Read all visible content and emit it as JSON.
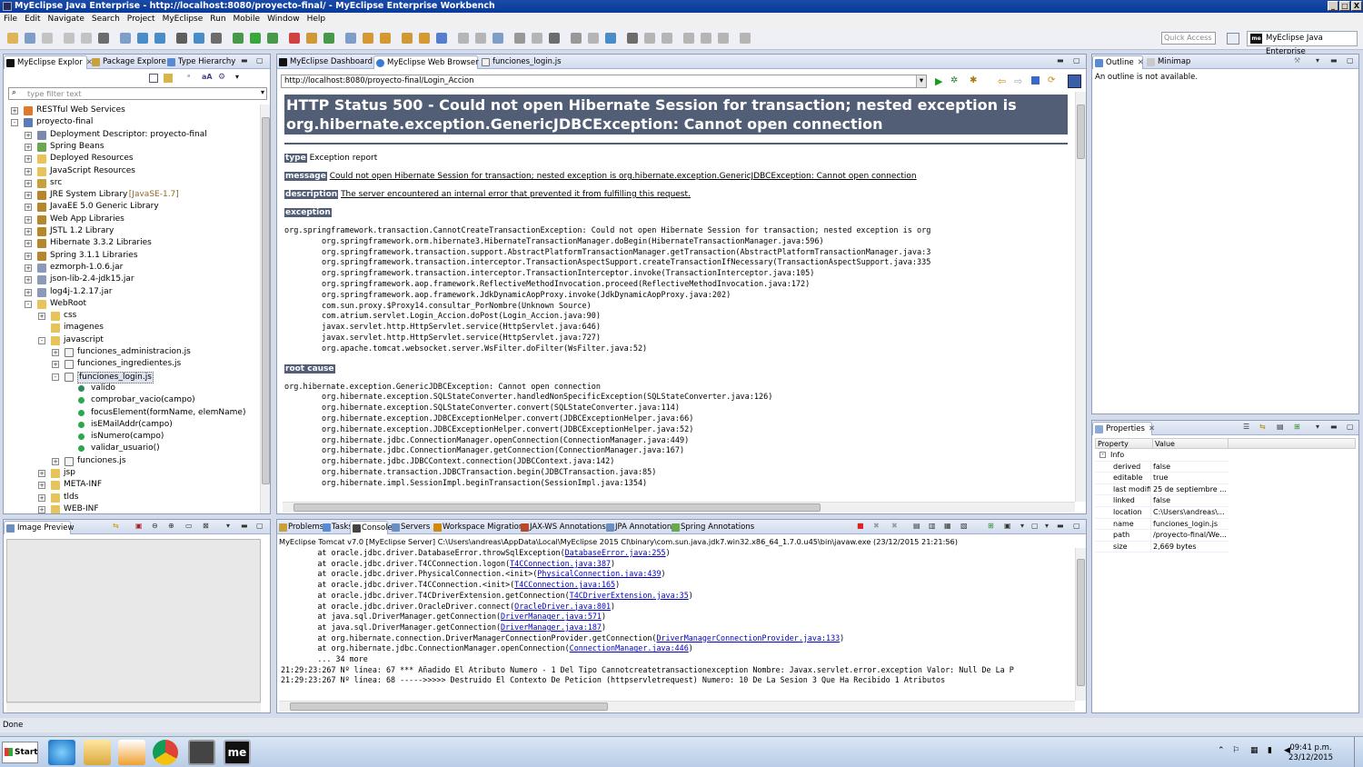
{
  "window": {
    "title": "MyEclipse Java Enterprise - http://localhost:8080/proyecto-final/ - MyEclipse Enterprise Workbench",
    "controls": [
      "_",
      "□",
      "X"
    ]
  },
  "menu": [
    "File",
    "Edit",
    "Navigate",
    "Search",
    "Project",
    "MyEclipse",
    "Run",
    "Mobile",
    "Window",
    "Help"
  ],
  "toolbar": {
    "quick_access_placeholder": "Quick Access",
    "perspective_label": "MyEclipse Java Enterprise",
    "perspective_badge": "me"
  },
  "left_panel": {
    "tabs": [
      "MyEclipse Explor",
      "Package Explore",
      "Type Hierarchy"
    ],
    "filter_placeholder": "type filter text",
    "tree": [
      {
        "label": "RESTful Web Services",
        "depth": 0,
        "expander": "+",
        "icon": "rest-icon"
      },
      {
        "label": "proyecto-final",
        "depth": 0,
        "expander": "-",
        "icon": "project-icon"
      },
      {
        "label": "Deployment Descriptor: proyecto-final",
        "depth": 1,
        "expander": "+",
        "icon": "descriptor-icon"
      },
      {
        "label": "Spring Beans",
        "depth": 1,
        "expander": "+",
        "icon": "spring-icon"
      },
      {
        "label": "Deployed Resources",
        "depth": 1,
        "expander": "+",
        "icon": "folder-icon"
      },
      {
        "label": "JavaScript Resources",
        "depth": 1,
        "expander": "+",
        "icon": "folder-icon"
      },
      {
        "label": "src",
        "depth": 1,
        "expander": "+",
        "icon": "package-folder-icon"
      },
      {
        "label": "JRE System Library",
        "suffix": "[JavaSE-1.7]",
        "depth": 1,
        "expander": "+",
        "icon": "library-icon"
      },
      {
        "label": "JavaEE 5.0 Generic Library",
        "depth": 1,
        "expander": "+",
        "icon": "library-icon"
      },
      {
        "label": "Web App Libraries",
        "depth": 1,
        "expander": "+",
        "icon": "library-icon"
      },
      {
        "label": "JSTL 1.2 Library",
        "depth": 1,
        "expander": "+",
        "icon": "library-icon"
      },
      {
        "label": "Hibernate 3.3.2 Libraries",
        "depth": 1,
        "expander": "+",
        "icon": "library-icon"
      },
      {
        "label": "Spring 3.1.1 Libraries",
        "depth": 1,
        "expander": "+",
        "icon": "library-icon"
      },
      {
        "label": "ezmorph-1.0.6.jar",
        "depth": 1,
        "expander": "+",
        "icon": "jar-icon"
      },
      {
        "label": "json-lib-2.4-jdk15.jar",
        "depth": 1,
        "expander": "+",
        "icon": "jar-icon"
      },
      {
        "label": "log4j-1.2.17.jar",
        "depth": 1,
        "expander": "+",
        "icon": "jar-icon"
      },
      {
        "label": "WebRoot",
        "depth": 1,
        "expander": "-",
        "icon": "folder-icon"
      },
      {
        "label": "css",
        "depth": 2,
        "expander": "+",
        "icon": "folder-icon"
      },
      {
        "label": "imagenes",
        "depth": 2,
        "expander": "",
        "icon": "folder-icon"
      },
      {
        "label": "javascript",
        "depth": 2,
        "expander": "-",
        "icon": "folder-icon"
      },
      {
        "label": "funciones_administracion.js",
        "depth": 3,
        "expander": "+",
        "icon": "js-file-icon"
      },
      {
        "label": "funciones_ingredientes.js",
        "depth": 3,
        "expander": "+",
        "icon": "js-file-icon"
      },
      {
        "label": "funciones_login.js",
        "depth": 3,
        "expander": "-",
        "icon": "js-file-icon",
        "selected": true
      },
      {
        "label": "valido",
        "depth": 4,
        "expander": "",
        "icon": "field-icon"
      },
      {
        "label": "comprobar_vacio(campo)",
        "depth": 4,
        "expander": "",
        "icon": "function-icon"
      },
      {
        "label": "focusElement(formName, elemName)",
        "depth": 4,
        "expander": "",
        "icon": "function-icon"
      },
      {
        "label": "isEMailAddr(campo)",
        "depth": 4,
        "expander": "",
        "icon": "function-icon"
      },
      {
        "label": "isNumero(campo)",
        "depth": 4,
        "expander": "",
        "icon": "function-icon"
      },
      {
        "label": "validar_usuario()",
        "depth": 4,
        "expander": "",
        "icon": "function-icon"
      },
      {
        "label": "funciones.js",
        "depth": 3,
        "expander": "+",
        "icon": "js-file-icon"
      },
      {
        "label": "jsp",
        "depth": 2,
        "expander": "+",
        "icon": "folder-icon"
      },
      {
        "label": "META-INF",
        "depth": 2,
        "expander": "+",
        "icon": "folder-icon"
      },
      {
        "label": "tlds",
        "depth": 2,
        "expander": "+",
        "icon": "folder-icon"
      },
      {
        "label": "WEB-INF",
        "depth": 2,
        "expander": "+",
        "icon": "folder-icon"
      }
    ]
  },
  "image_preview": {
    "tab": "Image Preview"
  },
  "editor": {
    "tabs": [
      "MyEclipse Dashboard",
      "MyEclipse Web Browser",
      "funciones_login.js"
    ],
    "url": "http://localhost:8080/proyecto-final/Login_Accion",
    "heading_line1": "HTTP Status 500 - Could not open Hibernate Session for transaction; nested exception is",
    "heading_line2": "org.hibernate.exception.GenericJDBCException: Cannot open connection",
    "type_label": "type",
    "type_value": "Exception report",
    "message_label": "message",
    "message_value": "Could not open Hibernate Session for transaction; nested exception is org.hibernate.exception.GenericJDBCException: Cannot open connection",
    "description_label": "description",
    "description_value": "The server encountered an internal error that prevented it from fulfilling this request.",
    "exception_label": "exception",
    "exception_trace": "org.springframework.transaction.CannotCreateTransactionException: Could not open Hibernate Session for transaction; nested exception is org\n\torg.springframework.orm.hibernate3.HibernateTransactionManager.doBegin(HibernateTransactionManager.java:596)\n\torg.springframework.transaction.support.AbstractPlatformTransactionManager.getTransaction(AbstractPlatformTransactionManager.java:3\n\torg.springframework.transaction.interceptor.TransactionAspectSupport.createTransactionIfNecessary(TransactionAspectSupport.java:335\n\torg.springframework.transaction.interceptor.TransactionInterceptor.invoke(TransactionInterceptor.java:105)\n\torg.springframework.aop.framework.ReflectiveMethodInvocation.proceed(ReflectiveMethodInvocation.java:172)\n\torg.springframework.aop.framework.JdkDynamicAopProxy.invoke(JdkDynamicAopProxy.java:202)\n\tcom.sun.proxy.$Proxy14.consultar_PorNombre(Unknown Source)\n\tcom.atrium.servlet.Login_Accion.doPost(Login_Accion.java:90)\n\tjavax.servlet.http.HttpServlet.service(HttpServlet.java:646)\n\tjavax.servlet.http.HttpServlet.service(HttpServlet.java:727)\n\torg.apache.tomcat.websocket.server.WsFilter.doFilter(WsFilter.java:52)",
    "root_cause_label": "root cause",
    "root_cause_trace": "org.hibernate.exception.GenericJDBCException: Cannot open connection\n\torg.hibernate.exception.SQLStateConverter.handledNonSpecificException(SQLStateConverter.java:126)\n\torg.hibernate.exception.SQLStateConverter.convert(SQLStateConverter.java:114)\n\torg.hibernate.exception.JDBCExceptionHelper.convert(JDBCExceptionHelper.java:66)\n\torg.hibernate.exception.JDBCExceptionHelper.convert(JDBCExceptionHelper.java:52)\n\torg.hibernate.jdbc.ConnectionManager.openConnection(ConnectionManager.java:449)\n\torg.hibernate.jdbc.ConnectionManager.getConnection(ConnectionManager.java:167)\n\torg.hibernate.jdbc.JDBCContext.connection(JDBCContext.java:142)\n\torg.hibernate.transaction.JDBCTransaction.begin(JDBCTransaction.java:85)\n\torg.hibernate.impl.SessionImpl.beginTransaction(SessionImpl.java:1354)"
  },
  "console": {
    "tabs": [
      "Problems",
      "Tasks",
      "Console",
      "Servers",
      "Workspace Migration",
      "JAX-WS Annotations",
      "JPA Annotations",
      "Spring Annotations"
    ],
    "header": "MyEclipse Tomcat v7.0 [MyEclipse Server] C:\\Users\\andreas\\AppData\\Local\\MyEclipse 2015 CI\\binary\\com.sun.java.jdk7.win32.x86_64_1.7.0.u45\\bin\\javaw.exe (23/12/2015 21:21:56)",
    "lines": [
      {
        "pre": "        at oracle.jdbc.driver.DatabaseError.throwSqlException(",
        "link": "DatabaseError.java:255",
        "post": ")"
      },
      {
        "pre": "        at oracle.jdbc.driver.T4CConnection.logon(",
        "link": "T4CConnection.java:387",
        "post": ")"
      },
      {
        "pre": "        at oracle.jdbc.driver.PhysicalConnection.<init>(",
        "link": "PhysicalConnection.java:439",
        "post": ")"
      },
      {
        "pre": "        at oracle.jdbc.driver.T4CConnection.<init>(",
        "link": "T4CConnection.java:165",
        "post": ")"
      },
      {
        "pre": "        at oracle.jdbc.driver.T4CDriverExtension.getConnection(",
        "link": "T4CDriverExtension.java:35",
        "post": ")"
      },
      {
        "pre": "        at oracle.jdbc.driver.OracleDriver.connect(",
        "link": "OracleDriver.java:801",
        "post": ")"
      },
      {
        "pre": "        at java.sql.DriverManager.getConnection(",
        "link": "DriverManager.java:571",
        "post": ")"
      },
      {
        "pre": "        at java.sql.DriverManager.getConnection(",
        "link": "DriverManager.java:187",
        "post": ")"
      },
      {
        "pre": "        at org.hibernate.connection.DriverManagerConnectionProvider.getConnection(",
        "link": "DriverManagerConnectionProvider.java:133",
        "post": ")"
      },
      {
        "pre": "        at org.hibernate.jdbc.ConnectionManager.openConnection(",
        "link": "ConnectionManager.java:446",
        "post": ")"
      },
      {
        "pre": "        ... 34 more",
        "link": "",
        "post": ""
      },
      {
        "pre": "21:29:23:267 Nº línea: 67 *** Añadido El Atributo Numero - 1 Del Tipo Cannotcreatetransactionexception Nombre: Javax.servlet.error.exception Valor: Null De La P",
        "link": "",
        "post": ""
      },
      {
        "pre": "21:29:23:267 Nº línea: 68 ----->>>>> Destruido El Contexto De Peticion (httpservletrequest) Numero: 10 De La Sesion 3 Que Ha Recibido 1 Atributos",
        "link": "",
        "post": ""
      }
    ]
  },
  "outline": {
    "tabs": [
      "Outline",
      "Minimap"
    ],
    "message": "An outline is not available."
  },
  "properties": {
    "tab": "Properties",
    "columns": [
      "Property",
      "Value"
    ],
    "group": "Info",
    "rows": [
      {
        "k": "derived",
        "v": "false"
      },
      {
        "k": "editable",
        "v": "true"
      },
      {
        "k": "last modified",
        "v": "25 de septiembre ..."
      },
      {
        "k": "linked",
        "v": "false"
      },
      {
        "k": "location",
        "v": "C:\\Users\\andreas\\..."
      },
      {
        "k": "name",
        "v": "funciones_login.js"
      },
      {
        "k": "path",
        "v": "/proyecto-final/We..."
      },
      {
        "k": "size",
        "v": "2,669  bytes"
      }
    ]
  },
  "status": {
    "text": "Done"
  },
  "taskbar": {
    "start_label": "Start",
    "time": "09:41 p.m.",
    "date": "23/12/2015",
    "apps": [
      "ie-icon",
      "explorer-icon",
      "media-player-icon",
      "chrome-icon",
      "sublime-icon",
      "myeclipse-icon"
    ]
  },
  "colors": {
    "title_blue": "#0a3a9a",
    "tomcat_header": "#525d76",
    "link_blue": "#0000c0"
  }
}
